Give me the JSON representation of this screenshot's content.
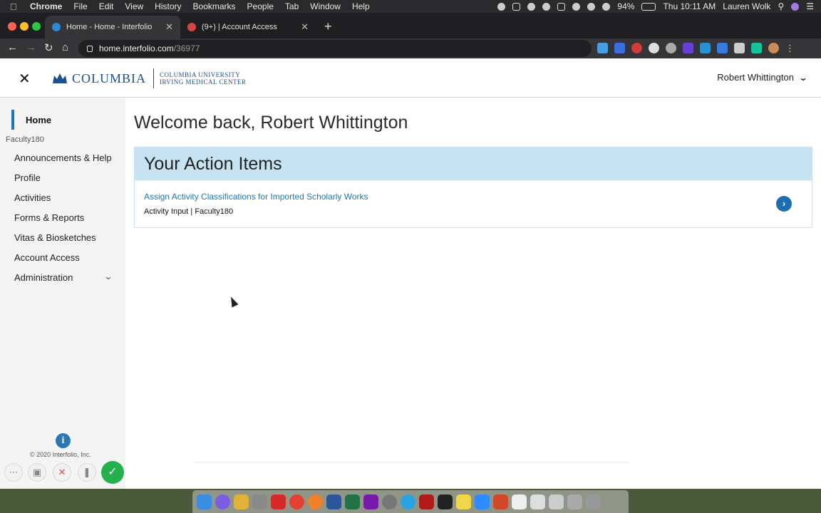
{
  "menubar": {
    "app": "Chrome",
    "items": [
      "File",
      "Edit",
      "View",
      "History",
      "Bookmarks",
      "People",
      "Tab",
      "Window",
      "Help"
    ],
    "battery": "94%",
    "clock": "Thu 10:11 AM",
    "user": "Lauren Wolk"
  },
  "browser": {
    "tabs": [
      {
        "title": "Home - Home - Interfolio",
        "active": true
      },
      {
        "title": "(9+) | Account Access",
        "active": false
      }
    ],
    "url_host": "home.interfolio.com",
    "url_path": "/36977"
  },
  "header": {
    "logo_word": "COLUMBIA",
    "logo_sub_line1": "COLUMBIA UNIVERSITY",
    "logo_sub_line2": "IRVING MEDICAL CENTER",
    "user_name": "Robert Whittington"
  },
  "sidebar": {
    "home": "Home",
    "group": "Faculty180",
    "items": [
      "Announcements & Help",
      "Profile",
      "Activities",
      "Forms & Reports",
      "Vitas & Biosketches",
      "Account Access",
      "Administration"
    ],
    "copyright": "© 2020 Interfolio, Inc."
  },
  "main": {
    "welcome": "Welcome back, Robert Whittington",
    "action_title": "Your Action Items",
    "action_link": "Assign Activity Classifications for Imported Scholarly Works",
    "action_meta": "Activity Input | Faculty180"
  },
  "colors": {
    "accent": "#1a76b8",
    "action_header_bg": "#c7e3f2",
    "link": "#1d78b3",
    "columbia_blue": "#1d4f91"
  }
}
